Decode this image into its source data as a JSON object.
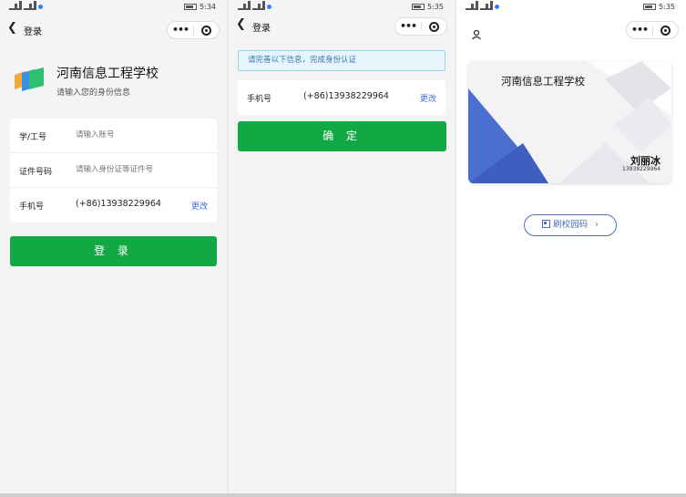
{
  "screens": [
    {
      "status": {
        "left_text": "",
        "right_time": "5:34"
      },
      "nav": {
        "title": "登录"
      },
      "school": {
        "name": "河南信息工程学校",
        "subtitle": "请输入您的身份信息"
      },
      "form": {
        "student_id_label": "学/工号",
        "student_id_placeholder": "请输入账号",
        "id_number_label": "证件号码",
        "id_number_placeholder": "请输入身份证等证件号",
        "phone_label": "手机号",
        "phone_value": "(+86)13938229964",
        "change_label": "更改"
      },
      "submit_label": "登 录"
    },
    {
      "status": {
        "right_time": "5:35"
      },
      "nav": {
        "title": "登录"
      },
      "notice": "请完善以下信息，完成身份认证",
      "form": {
        "phone_label": "手机号",
        "phone_value": "(+86)13938229964",
        "change_label": "更改"
      },
      "confirm_label": "确 定"
    },
    {
      "status": {
        "right_time": "5:35"
      },
      "card": {
        "school_name": "河南信息工程学校",
        "user_name": "刘丽冰",
        "user_phone": "13938229964",
        "accent": "#4a6fd0"
      },
      "scan_label": "刷校园码"
    }
  ],
  "colors": {
    "green": "#12a843",
    "link": "#3a6fd8",
    "notice_bg": "#e6f4fb"
  },
  "icons": [
    "back-arrow-icon",
    "more-dots-icon",
    "close-ring-icon",
    "school-logo-icon",
    "user-icon",
    "qr-code-icon",
    "chevron-right-icon"
  ]
}
